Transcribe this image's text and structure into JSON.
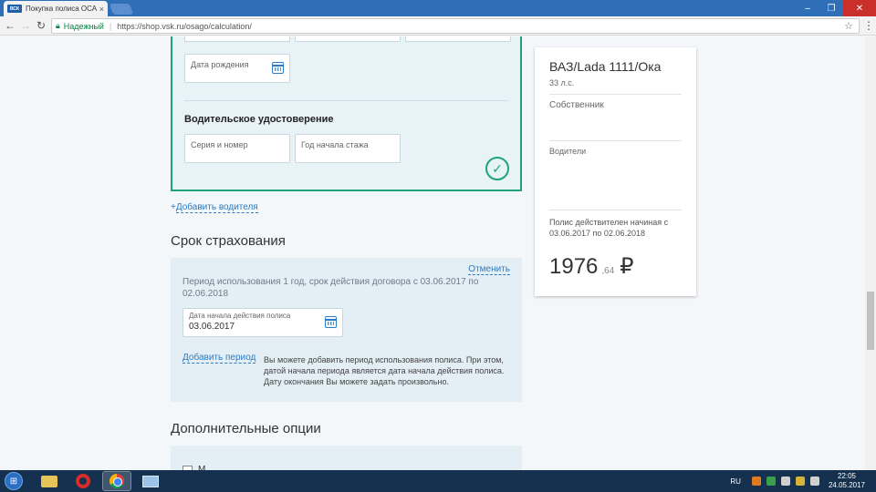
{
  "browser": {
    "tab_title": "Покупка полиса ОСАГО",
    "favicon_text": "ВСК",
    "secure_label": "Надежный",
    "url": "https://shop.vsk.ru/osago/calculation/"
  },
  "driver": {
    "birth_date_placeholder": "Дата рождения",
    "license_section_title": "Водительское удостоверение",
    "series_number_placeholder": "Серия и номер",
    "experience_start_placeholder": "Год начала стажа"
  },
  "add_driver": {
    "plus": "+",
    "label": "Добавить водителя"
  },
  "insurance_period": {
    "title": "Срок страхования",
    "cancel_label": "Отменить",
    "description": "Период использования 1 год, срок действия договора с 03.06.2017 по 02.06.2018",
    "start_date_label": "Дата начала действия полиса",
    "start_date_value": "03.06.2017",
    "add_period_label": "Добавить период",
    "add_period_info": "Вы можете добавить период использования полиса. При этом, датой начала периода является дата начала действия полиса. Дату окончания Вы можете задать произвольно."
  },
  "additional_options": {
    "title": "Дополнительные опции",
    "first_option_label": "М"
  },
  "summary": {
    "car_name": "ВАЗ/Lada 1111/Ока",
    "car_power": "33 л.с.",
    "owner_label": "Собственник",
    "drivers_label": "Водители",
    "validity_text": "Полис действителен начиная с 03.06.2017 по 02.06.2018",
    "price_rub": "1976",
    "price_kop": ",64",
    "currency": "₽"
  },
  "taskbar": {
    "lang": "RU",
    "time": "22:05",
    "date": "24.05.2017"
  },
  "colors": {
    "accent_green": "#1fa37a",
    "link_blue": "#2b7cc4",
    "taskbar": "#16314f",
    "titlebar": "#2e6fb8"
  }
}
